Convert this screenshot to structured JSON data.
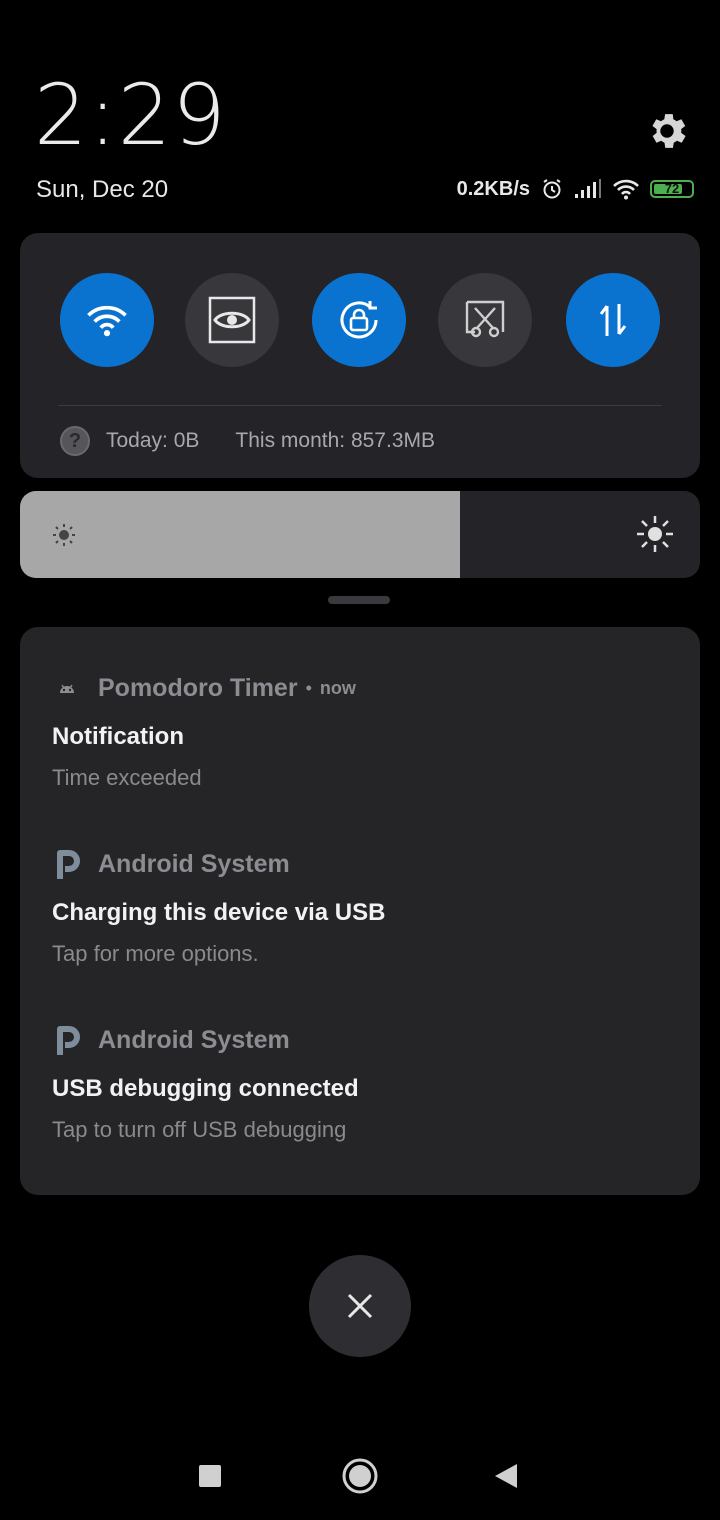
{
  "header": {
    "time": "2:29",
    "date": "Sun, Dec 20",
    "net_speed": "0.2KB/s",
    "battery": "72"
  },
  "quick_settings": {
    "tiles": [
      {
        "name": "wifi",
        "state": "on",
        "icon": "wifi-icon"
      },
      {
        "name": "reading-mode",
        "state": "off",
        "icon": "eye-icon"
      },
      {
        "name": "auto-rotate",
        "state": "on",
        "icon": "rotate-lock-icon"
      },
      {
        "name": "screenshot",
        "state": "off",
        "icon": "scissors-icon"
      },
      {
        "name": "mobile-data",
        "state": "on",
        "icon": "data-arrows-icon"
      }
    ],
    "usage_today": "Today: 0B",
    "usage_month": "This month: 857.3MB",
    "accent_color": "#0a73d0"
  },
  "brightness": {
    "level_fraction": 0.647
  },
  "notifications": [
    {
      "app": "Pomodoro Timer",
      "time": "now",
      "title": "Notification",
      "body": "Time exceeded",
      "icon": "android-icon"
    },
    {
      "app": "Android System",
      "time": "",
      "title": "Charging this device via USB",
      "body": "Tap for more options.",
      "icon": "p-icon"
    },
    {
      "app": "Android System",
      "time": "",
      "title": "USB debugging connected",
      "body": "Tap to turn off USB debugging",
      "icon": "p-icon"
    }
  ]
}
